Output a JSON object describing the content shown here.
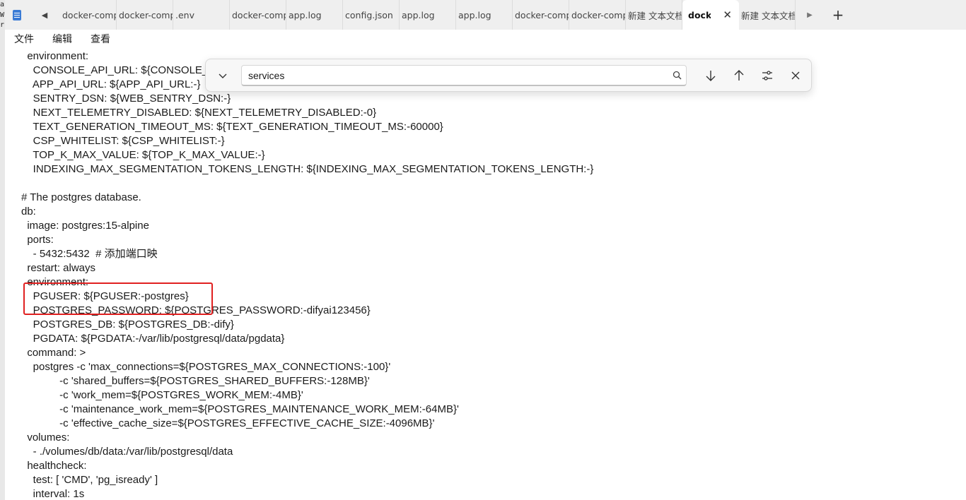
{
  "left_strip": [
    "a",
    "W",
    "r",
    "",
    "",
    "",
    "",
    "",
    "",
    "",
    "",
    "",
    "",
    "",
    "",
    "",
    "",
    "",
    "",
    "",
    "",
    "",
    "",
    "",
    "",
    "",
    "",
    "",
    "",
    "",
    "",
    "",
    "",
    "",
    "",
    "",
    "",
    "",
    "",
    "",
    "",
    "",
    "",
    "",
    "",
    "",
    "",
    "",
    "",
    ""
  ],
  "tabs": [
    {
      "label": "docker-comp"
    },
    {
      "label": "docker-comp"
    },
    {
      "label": ".env"
    },
    {
      "label": "docker-comp"
    },
    {
      "label": "app.log"
    },
    {
      "label": "config.json"
    },
    {
      "label": "app.log"
    },
    {
      "label": "app.log"
    },
    {
      "label": "docker-comp"
    },
    {
      "label": "docker-comp"
    },
    {
      "label": "新建 文本文档"
    },
    {
      "label": "docke",
      "active": true
    },
    {
      "label": "新建 文本文档"
    }
  ],
  "menu": {
    "file": "文件",
    "edit": "编辑",
    "view": "查看"
  },
  "find": {
    "query": "services"
  },
  "code_lines": [
    "  environment:",
    "    CONSOLE_API_URL: ${CONSOLE_API_URL:-}",
    "    APP_API_URL: ${APP_API_URL:-}",
    "    SENTRY_DSN: ${WEB_SENTRY_DSN:-}",
    "    NEXT_TELEMETRY_DISABLED: ${NEXT_TELEMETRY_DISABLED:-0}",
    "    TEXT_GENERATION_TIMEOUT_MS: ${TEXT_GENERATION_TIMEOUT_MS:-60000}",
    "    CSP_WHITELIST: ${CSP_WHITELIST:-}",
    "    TOP_K_MAX_VALUE: ${TOP_K_MAX_VALUE:-}",
    "    INDEXING_MAX_SEGMENTATION_TOKENS_LENGTH: ${INDEXING_MAX_SEGMENTATION_TOKENS_LENGTH:-}",
    "",
    "# The postgres database.",
    "db:",
    "  image: postgres:15-alpine",
    "  ports:",
    "    - 5432:5432  # 添加端口映",
    "  restart: always",
    "  environment:",
    "    PGUSER: ${PGUSER:-postgres}",
    "    POSTGRES_PASSWORD: ${POSTGRES_PASSWORD:-difyai123456}",
    "    POSTGRES_DB: ${POSTGRES_DB:-dify}",
    "    PGDATA: ${PGDATA:-/var/lib/postgresql/data/pgdata}",
    "  command: >",
    "    postgres -c 'max_connections=${POSTGRES_MAX_CONNECTIONS:-100}'",
    "             -c 'shared_buffers=${POSTGRES_SHARED_BUFFERS:-128MB}'",
    "             -c 'work_mem=${POSTGRES_WORK_MEM:-4MB}'",
    "             -c 'maintenance_work_mem=${POSTGRES_MAINTENANCE_WORK_MEM:-64MB}'",
    "             -c 'effective_cache_size=${POSTGRES_EFFECTIVE_CACHE_SIZE:-4096MB}'",
    "  volumes:",
    "    - ./volumes/db/data:/var/lib/postgresql/data",
    "  healthcheck:",
    "    test: [ 'CMD', 'pg_isready' ]",
    "    interval: 1s"
  ]
}
